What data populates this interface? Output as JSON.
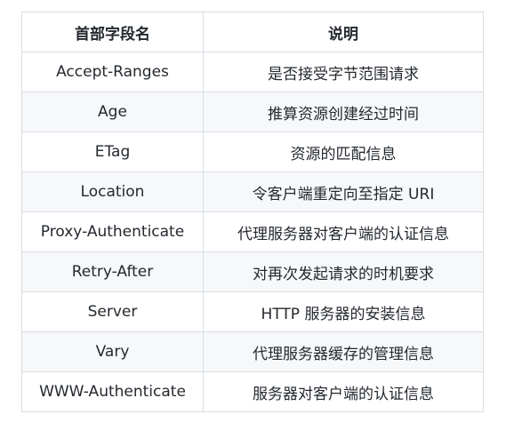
{
  "table": {
    "headers": [
      "首部字段名",
      "说明"
    ],
    "rows": [
      [
        "Accept-Ranges",
        "是否接受字节范围请求"
      ],
      [
        "Age",
        "推算资源创建经过时间"
      ],
      [
        "ETag",
        "资源的匹配信息"
      ],
      [
        "Location",
        "令客户端重定向至指定 URI"
      ],
      [
        "Proxy-Authenticate",
        "代理服务器对客户端的认证信息"
      ],
      [
        "Retry-After",
        "对再次发起请求的时机要求"
      ],
      [
        "Server",
        "HTTP 服务器的安装信息"
      ],
      [
        "Vary",
        "代理服务器缓存的管理信息"
      ],
      [
        "WWW-Authenticate",
        "服务器对客户端的认证信息"
      ]
    ]
  }
}
